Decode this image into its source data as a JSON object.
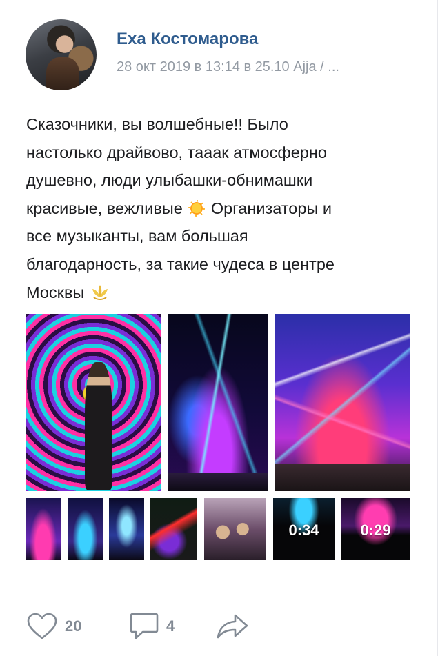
{
  "post": {
    "author": "Еха Костомарова",
    "meta": "28 окт 2019 в 13:14 в 25.10 Ajja / ...",
    "text_before_sun": "Сказочники, вы волшебные!! Было\nнастолько драйвово, тааак атмосферно\nдушевно, люди улыбашки-обнимашки\nкрасивые, вежливые ",
    "text_after_sun": " Организаторы и\nвсе музыканты, вам большая\nблагодарность, за такие чудеса в центре\nМосквы ",
    "emoji": [
      "sun-emoji",
      "lotus-emoji"
    ]
  },
  "media": {
    "photos": [
      "photo-portrait",
      "photo-stage-lasers",
      "photo-stage-crowd"
    ],
    "thumbnails": [
      "thumb-1",
      "thumb-2",
      "thumb-3",
      "thumb-4",
      "thumb-5"
    ],
    "videos": [
      {
        "duration": "0:34"
      },
      {
        "duration": "0:29"
      }
    ]
  },
  "actions": {
    "likes": "20",
    "comments": "4",
    "icons": [
      "heart-icon",
      "comment-icon",
      "share-icon"
    ],
    "icon_color": "#828a94"
  },
  "colors": {
    "author": "#2f5c8e",
    "meta": "#939aa3",
    "text": "#1d1e21"
  }
}
